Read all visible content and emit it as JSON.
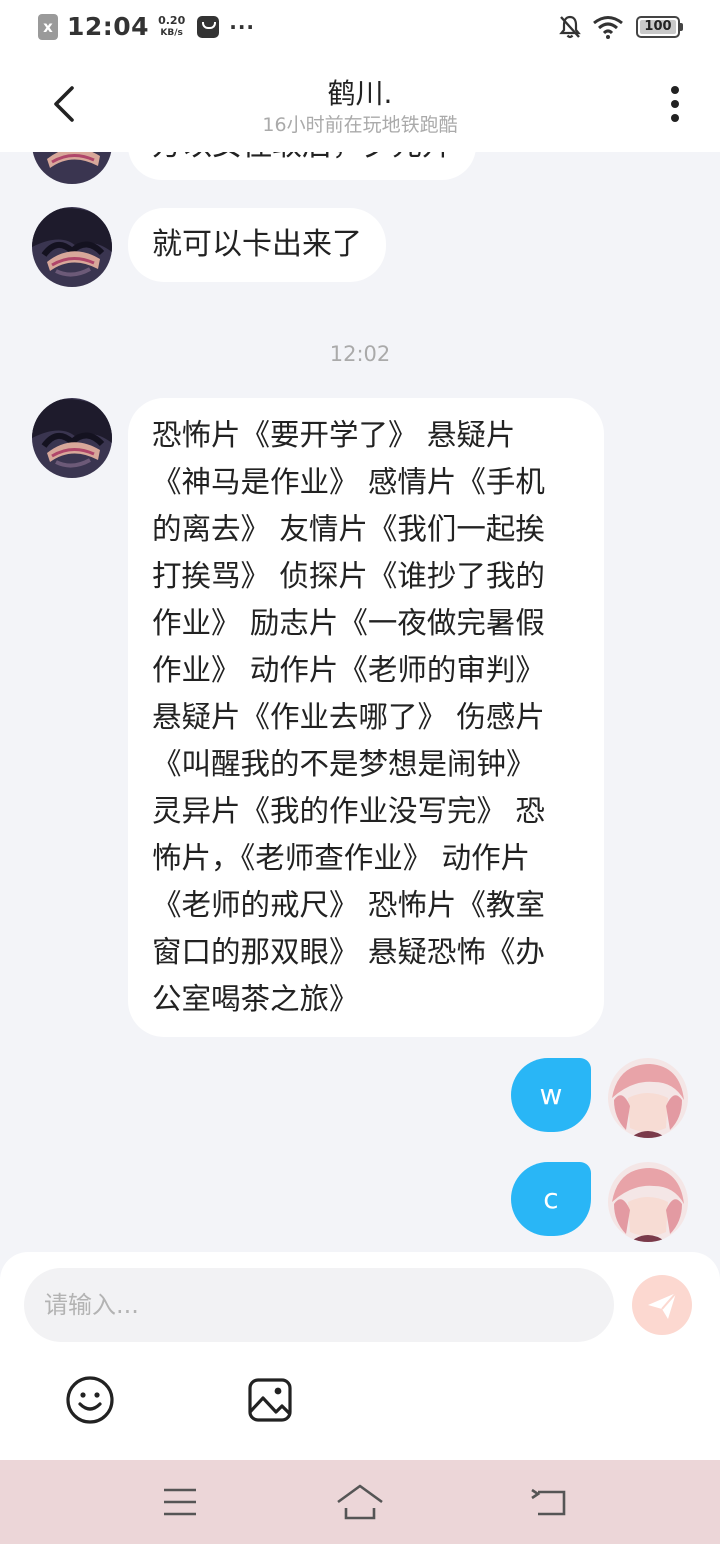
{
  "status_bar": {
    "time": "12:04",
    "speed_value": "0.20",
    "speed_unit": "KB/s",
    "more": "···",
    "battery": "100",
    "x_icon": "x"
  },
  "header": {
    "title": "鹤川.",
    "subtitle": "16小时前在玩地铁跑酷"
  },
  "messages": [
    {
      "side": "left",
      "text": "方以女住取后，夕元升"
    },
    {
      "side": "left",
      "text": "就可以卡出来了"
    },
    {
      "side": "time",
      "text": "12:02"
    },
    {
      "side": "left",
      "lines": [
        "恐怖片《要开学了》 悬疑片",
        "《神马是作业》 感情片《手机",
        "的离去》 友情片《我们一起挨",
        "打挨骂》 侦探片《谁抄了我的",
        "作业》 励志片《一夜做完暑假",
        "作业》 动作片《老师的审判》",
        "悬疑片《作业去哪了》 伤感片",
        "《叫醒我的不是梦想是闹钟》",
        "灵异片《我的作业没写完》 恐",
        "怖片，《老师查作业》 动作片",
        "《老师的戒尺》 恐怖片《教室",
        "窗口的那双眼》 悬疑恐怖《办",
        "公室喝茶之旅》"
      ]
    },
    {
      "side": "right",
      "text": "w"
    },
    {
      "side": "right",
      "text": "c"
    }
  ],
  "input": {
    "placeholder": "请输入..."
  },
  "colors": {
    "accent": "#29b6f6",
    "send_button": "#fcd8d0",
    "nav_bar": "#ecd6d8",
    "chat_bg": "#f3f4f8"
  },
  "icons": [
    "back-arrow-icon",
    "more-vertical-icon",
    "send-icon",
    "emoji-icon",
    "image-icon",
    "menu-icon",
    "home-icon",
    "back-nav-icon"
  ]
}
